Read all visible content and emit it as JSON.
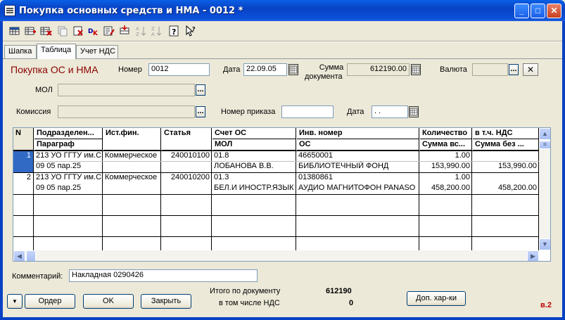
{
  "window": {
    "title": "Покупка основных средств и НМА - 0012 *",
    "minimize": "_",
    "maximize": "□",
    "close": "✕"
  },
  "toolbar": {
    "icons": [
      "add-row-icon",
      "add-row-copy-icon",
      "delete-row-icon",
      "copy-icon",
      "delete-icon",
      "dk-icon",
      "edit-icon",
      "insert-icon",
      "sort-asc-icon",
      "sort-desc-icon",
      "help-icon",
      "context-help-icon"
    ]
  },
  "tabs": [
    {
      "label": "Шапка"
    },
    {
      "label": "Таблица"
    },
    {
      "label": "Учет НДС"
    }
  ],
  "header": {
    "title": "Покупка ОС и НМА",
    "number_label": "Номер",
    "number_value": "0012",
    "date_label": "Дата",
    "date_value": "22.09.05",
    "sum_label_1": "Сумма",
    "sum_label_2": "документа",
    "sum_value": "612190.00",
    "currency_label": "Валюта",
    "currency_value": "",
    "mol_label": "МОЛ",
    "mol_value": "",
    "commission_label": "Комиссия",
    "commission_value": "",
    "order_no_label": "Номер приказа",
    "order_no_value": "",
    "order_date_label": "Дата",
    "order_date_value": " .  .  "
  },
  "grid": {
    "columns": [
      {
        "top": "N",
        "bottom": ""
      },
      {
        "top": "Подразделен...",
        "bottom": "Параграф"
      },
      {
        "top": "Ист.фин.",
        "bottom": ""
      },
      {
        "top": "Статья",
        "bottom": ""
      },
      {
        "top": "Счет ОС",
        "bottom": "МОЛ"
      },
      {
        "top": "Инв. номер",
        "bottom": "ОС"
      },
      {
        "top": "Количество",
        "bottom": "Сумма вс..."
      },
      {
        "top": "в т.ч. НДС",
        "bottom": "Сумма без ..."
      }
    ],
    "rows": [
      {
        "n": "1",
        "dept": "213 УО ГГТУ им.С",
        "paragraph": "09 05 пар.25",
        "source": "Коммерческое",
        "article": "240010100",
        "account": "01.8",
        "mol": "ЛОБАНОВА В.В.",
        "inv": "46650001",
        "asset": "БИБЛИОТЕЧНЫЙ ФОНД",
        "qty": "1.00",
        "sum_total": "153,990.00",
        "vat": "",
        "sum_without": "153,990.00"
      },
      {
        "n": "2",
        "dept": "213 УО ГГТУ им.С",
        "paragraph": "09 05 пар.25",
        "source": "Коммерческое",
        "article": "240010200",
        "account": "01.3",
        "mol": "БЕЛ.И ИНОСТР.ЯЗЫК",
        "inv": "01380861",
        "asset": "АУДИО МАГНИТОФОН PANASO",
        "qty": "1.00",
        "sum_total": "458,200.00",
        "vat": "",
        "sum_without": "458,200.00"
      }
    ]
  },
  "footer": {
    "comment_label": "Комментарий:",
    "comment_value": "Накладная 0290426",
    "total_label": "Итого по документу",
    "total_value": "612190",
    "vat_label": "в том числе НДС",
    "vat_value": "0",
    "order_button": "Ордер",
    "ok_button": "OK",
    "close_button": "Закрыть",
    "extra_button": "Доп. хар-ки",
    "version": "в.2",
    "menu_arrow": "▼"
  },
  "colors": {
    "title_bar": "#0842c4",
    "header_title": "#8b0000",
    "version": "#c00000",
    "selection": "#316ac5"
  }
}
